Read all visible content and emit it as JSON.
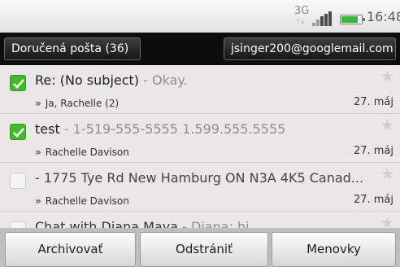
{
  "status_bar": {
    "network": "3G",
    "time": "16:48"
  },
  "header": {
    "inbox_label": "Doručená pošta (36)",
    "account": "jsinger200@googlemail.com"
  },
  "messages": [
    {
      "subject": "Re: (No subject)",
      "snippet": " - Okay.",
      "sender": "Ja, Rachelle (2)",
      "date": "27. máj",
      "checked": true,
      "read": false
    },
    {
      "subject": "test",
      "snippet": " - 1-519-555-5555 1.599.555.5555",
      "sender": "Rachelle Davison",
      "date": "27. máj",
      "checked": true,
      "read": false
    },
    {
      "subject": "",
      "snippet": " - 1775 Tye Rd New Hamburg ON N3A 4K5 Canad...",
      "sender": "Rachelle Davison",
      "date": "27. máj",
      "checked": false,
      "read": true
    },
    {
      "subject": "Chat with Diana Maya",
      "snippet": " - Diana: hi",
      "sender": "",
      "date": "",
      "checked": false,
      "read": true
    }
  ],
  "toolbar": {
    "archive": "Archivovať",
    "delete": "Odstrániť",
    "labels": "Menovky"
  },
  "colors": {
    "checkbox_on": "#43ba2a",
    "header_bg": "#0d0d0d",
    "list_bg": "#e9e7e8"
  }
}
